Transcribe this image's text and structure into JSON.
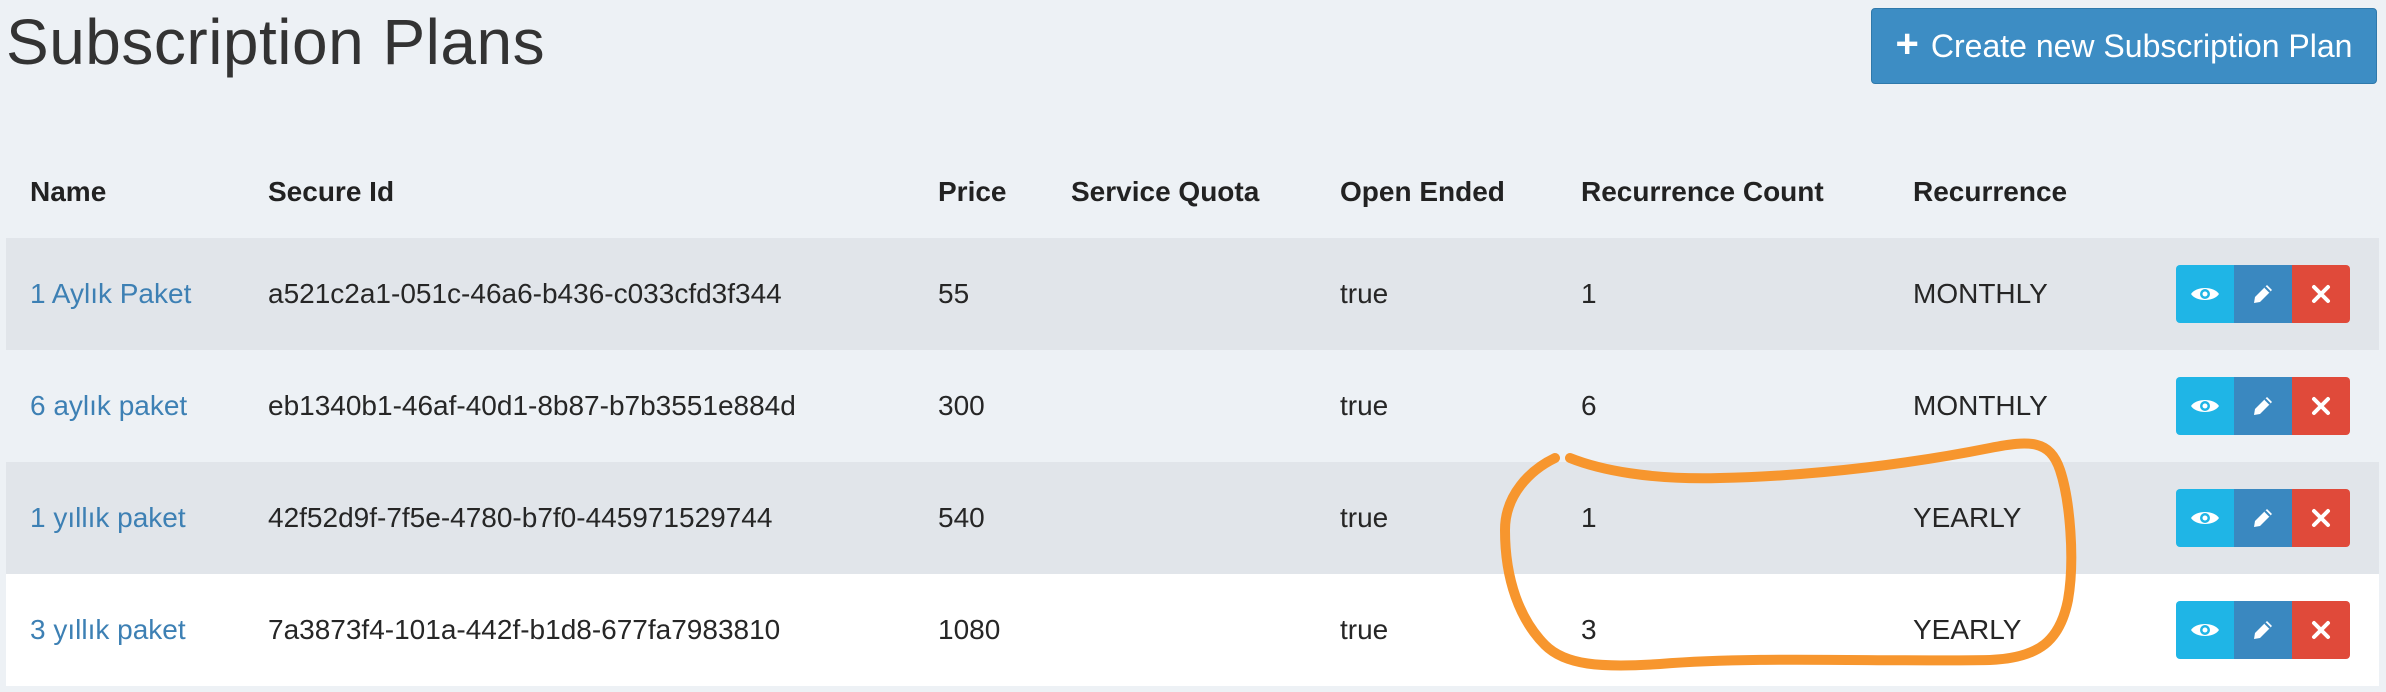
{
  "page": {
    "title": "Subscription Plans"
  },
  "create_button": {
    "label": "Create new Subscription Plan",
    "icon": "plus-icon"
  },
  "table": {
    "columns": [
      "Name",
      "Secure Id",
      "Price",
      "Service Quota",
      "Open Ended",
      "Recurrence Count",
      "Recurrence"
    ],
    "rows": [
      {
        "name": "1 Aylık Paket",
        "secure_id": "a521c2a1-051c-46a6-b436-c033cfd3f344",
        "price": "55",
        "service_quota": "",
        "open_ended": "true",
        "recurrence_count": "1",
        "recurrence": "MONTHLY"
      },
      {
        "name": "6 aylık paket",
        "secure_id": "eb1340b1-46af-40d1-8b87-b7b3551e884d",
        "price": "300",
        "service_quota": "",
        "open_ended": "true",
        "recurrence_count": "6",
        "recurrence": "MONTHLY"
      },
      {
        "name": "1 yıllık paket",
        "secure_id": "42f52d9f-7f5e-4780-b7f0-445971529744",
        "price": "540",
        "service_quota": "",
        "open_ended": "true",
        "recurrence_count": "1",
        "recurrence": "YEARLY"
      },
      {
        "name": "3 yıllık paket",
        "secure_id": "7a3873f4-101a-442f-b1d8-677fa7983810",
        "price": "1080",
        "service_quota": "",
        "open_ended": "true",
        "recurrence_count": "3",
        "recurrence": "YEARLY"
      }
    ],
    "row_actions": [
      "eye-icon",
      "pencil-icon",
      "close-icon"
    ]
  },
  "colors": {
    "page_bg": "#edf1f5",
    "row_alt_bg": "#e1e5ea",
    "link": "#3d80b4",
    "primary_button": "#3d8dc4",
    "view_button": "#1fb5e6",
    "edit_button": "#3a88c0",
    "delete_button": "#e04a3a",
    "annotation": "#f7962e"
  }
}
